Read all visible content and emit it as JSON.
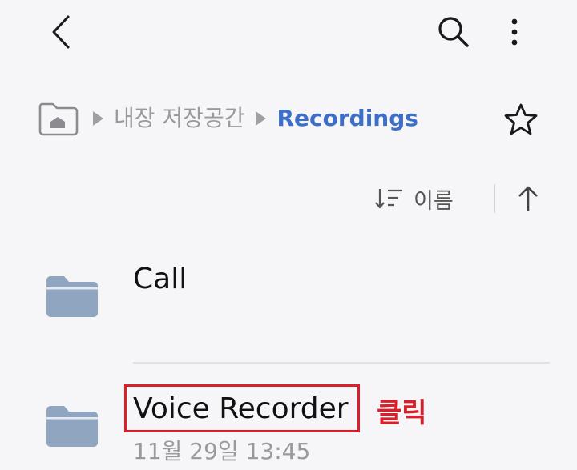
{
  "topbar": {
    "back_icon": "chevron-left-icon",
    "search_icon": "search-icon",
    "more_icon": "more-vertical-icon"
  },
  "breadcrumb": {
    "home_icon": "home-folder-icon",
    "separator_icon": "triangle-right-icon",
    "storage_label": "내장 저장공간",
    "current_label": "Recordings",
    "favorite_icon": "star-icon"
  },
  "sort": {
    "sort_icon": "sort-icon",
    "label": "이름",
    "direction_icon": "arrow-up-icon"
  },
  "files": [
    {
      "name": "Call",
      "icon": "folder-icon"
    },
    {
      "name": "Voice Recorder",
      "date": "11월 29일 13:45",
      "icon": "folder-icon"
    }
  ],
  "annotation": {
    "click_label": "클릭",
    "color": "#d81f2a"
  },
  "colors": {
    "accent": "#3e6fc8",
    "folder": "#8fa5c0",
    "background": "#f6f6f8"
  }
}
